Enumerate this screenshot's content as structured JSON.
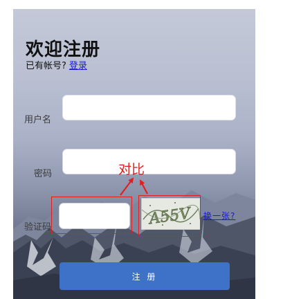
{
  "form": {
    "title": "欢迎注册",
    "have_account_text": "已有帐号?",
    "login_link": "登录",
    "username_label": "用户名",
    "password_label": "密码",
    "captcha_label": "验证码",
    "username_value": "",
    "password_value": "",
    "captcha_value": "",
    "captcha_image_text": "A55V",
    "refresh_link": "换一张?",
    "submit_label": "注 册"
  },
  "annotation": {
    "label": "对比",
    "color": "#e02020"
  },
  "colors": {
    "button": "#3d72c8",
    "link": "#1a1ad6"
  }
}
